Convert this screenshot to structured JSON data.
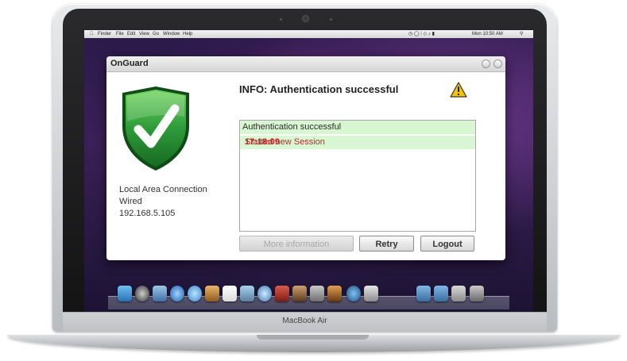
{
  "menubar": {
    "items": [
      "Finder",
      "File",
      "Edit",
      "View",
      "Go",
      "Window",
      "Help"
    ],
    "clock": "Mon 10:50 AM"
  },
  "window": {
    "title": "OnGuard",
    "connection": {
      "name": "Local Area Connection",
      "type": "Wired",
      "ip": "192.168.5.105"
    },
    "status_title": "INFO: Authentication successful",
    "log": [
      {
        "time": "",
        "message": "Authentication successful"
      },
      {
        "time": "17:18:09",
        "message": "Started new Session"
      }
    ],
    "buttons": {
      "more_info": "More information",
      "retry": "Retry",
      "logout": "Logout"
    }
  },
  "laptop": {
    "brand": "MacBook Air"
  },
  "icons": {
    "shield": "shield-check-icon",
    "warning": "warning-icon",
    "camera": "camera-icon"
  },
  "colors": {
    "shield_green": "#2e9b3a",
    "log_highlight": "#d9f6d2",
    "log_time": "#c0272d"
  }
}
